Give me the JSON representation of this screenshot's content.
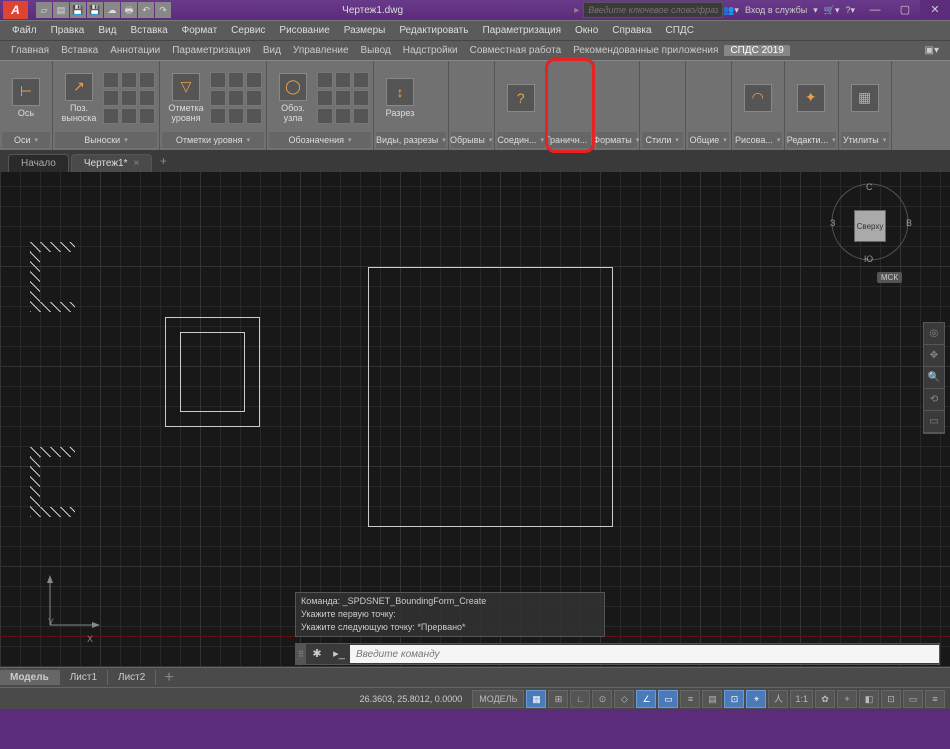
{
  "title": {
    "doc": "Чертеж1.dwg"
  },
  "search": {
    "placeholder": "Введите ключевое слово/фразу"
  },
  "login": {
    "label": "Вход в службы"
  },
  "winbtns": {
    "min": "—",
    "max": "▢",
    "close": "✕"
  },
  "menubar": [
    "Файл",
    "Правка",
    "Вид",
    "Вставка",
    "Формат",
    "Сервис",
    "Рисование",
    "Размеры",
    "Редактировать",
    "Параметризация",
    "Окно",
    "Справка",
    "СПДС"
  ],
  "tabs": [
    "Главная",
    "Вставка",
    "Аннотации",
    "Параметризация",
    "Вид",
    "Управление",
    "Вывод",
    "Надстройки",
    "Совместная работа",
    "Рекомендованные приложения",
    "СПДС 2019"
  ],
  "tabs_active_idx": 10,
  "ribbon": {
    "panels": [
      {
        "label": "Оси",
        "buttons": [
          {
            "text": "Ось",
            "glyph": "⊢"
          }
        ]
      },
      {
        "label": "Выноски",
        "buttons": [
          {
            "text": "Поз. выноска",
            "glyph": "↗"
          }
        ],
        "grid": true
      },
      {
        "label": "Отметки уровня",
        "buttons": [
          {
            "text": "Отметка уровня",
            "glyph": "▽"
          }
        ],
        "grid": true
      },
      {
        "label": "Обозначения",
        "buttons": [
          {
            "text": "Обоз. узла",
            "glyph": "◯"
          }
        ],
        "grid": true
      },
      {
        "label": "Виды, разрезы",
        "buttons": [
          {
            "text": "Разрез",
            "glyph": "↕"
          }
        ]
      },
      {
        "label": "Обрывы",
        "buttons": [],
        "narrow": true
      },
      {
        "label": "Соедин...",
        "buttons": [
          {
            "text": "",
            "glyph": "?"
          }
        ]
      },
      {
        "label": "Граничн...",
        "buttons": [],
        "narrow": true,
        "highlight": true
      },
      {
        "label": "Форматы",
        "buttons": [],
        "narrow": true
      },
      {
        "label": "Стили",
        "buttons": [],
        "narrow": true
      },
      {
        "label": "Общие",
        "buttons": [],
        "narrow": true
      },
      {
        "label": "Рисова...",
        "buttons": [
          {
            "text": "",
            "glyph": "◠"
          }
        ]
      },
      {
        "label": "Редакти...",
        "buttons": [
          {
            "text": "",
            "glyph": "✦"
          }
        ]
      },
      {
        "label": "Утилиты",
        "buttons": [
          {
            "text": "",
            "glyph": "▦"
          }
        ]
      }
    ]
  },
  "doctabs": [
    {
      "label": "Начало",
      "active": false
    },
    {
      "label": "Чертеж1*",
      "active": true
    }
  ],
  "viewcube": {
    "top": "Сверху",
    "n": "С",
    "s": "Ю",
    "e": "В",
    "w": "З",
    "wcs": "МСК"
  },
  "cmdhist": [
    "Команда: _SPDSNET_BoundingForm_Create",
    "Укажите первую точку:",
    "Укажите следующую точку: *Прервано*"
  ],
  "cmdline": {
    "placeholder": "Введите команду"
  },
  "layouts": [
    "Модель",
    "Лист1",
    "Лист2"
  ],
  "status": {
    "coords": "26.3603, 25.8012, 0.0000",
    "model": "МОДЕЛЬ",
    "scale": "1:1"
  },
  "ucs": {
    "x": "X",
    "y": "Y"
  }
}
